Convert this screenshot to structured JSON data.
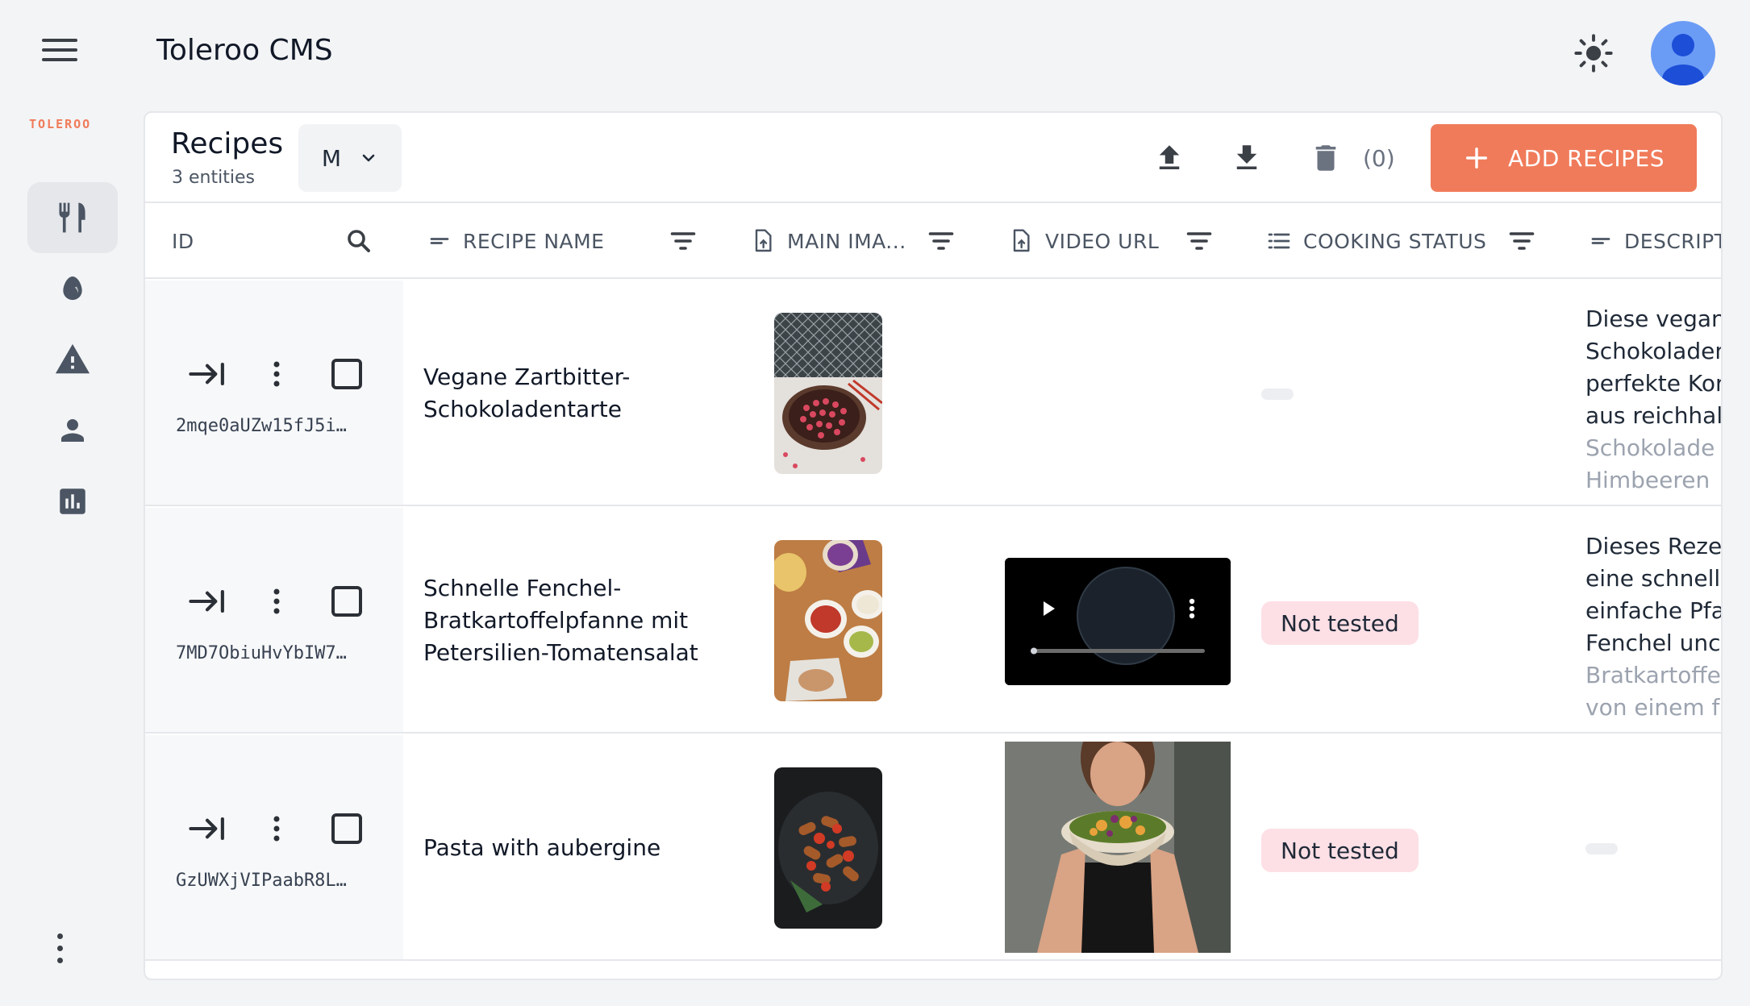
{
  "app": {
    "title": "Toleroo CMS",
    "brand": "TOLEROO"
  },
  "toolbar": {
    "title": "Recipes",
    "entity_count": "3 entities",
    "size_value": "M",
    "selected_count": "(0)",
    "add_label": "ADD RECIPES"
  },
  "sidebar": {
    "items": [
      {
        "icon": "utensils-icon",
        "active": true
      },
      {
        "icon": "egg-icon",
        "active": false
      },
      {
        "icon": "warning-icon",
        "active": false
      },
      {
        "icon": "person-icon",
        "active": false
      },
      {
        "icon": "chart-icon",
        "active": false
      }
    ]
  },
  "columns": {
    "id": "ID",
    "recipe_name": "RECIPE NAME",
    "main_image": "MAIN IMA...",
    "video_url": "VIDEO URL",
    "cooking_status": "COOKING STATUS",
    "description": "DESCRIPT"
  },
  "rows": [
    {
      "id": "2mqe0aUZw15fJ5i…",
      "name": "Vegane Zartbitter-Schokoladentarte",
      "image": "tart-photo",
      "video": "",
      "status": "",
      "desc_top": "Diese vegan\nSchokoladen\nperfekte Kor\naus reichhal",
      "desc_fade": "Schokolade\nHimbeeren"
    },
    {
      "id": "7MD7ObiuHvYbIW7…",
      "name": "Schnelle Fenchel-Bratkartoffelpfanne mit Petersilien-Tomatensalat",
      "image": "bowls-photo",
      "video": "player",
      "status": "Not tested",
      "desc_top": "Dieses Reze\neine schnell\neinfache Pfa\nFenchel unc",
      "desc_fade": "Bratkartoffe\nvon einem fr"
    },
    {
      "id": "GzUWXjVIPaabR8L…",
      "name": "Pasta with aubergine",
      "image": "pasta-photo",
      "video": "woman-photo",
      "status": "Not tested",
      "desc_top": "",
      "desc_fade": ""
    }
  ],
  "colors": {
    "accent": "#f07b5a",
    "badge_bg": "#fde0e6",
    "avatar": "#6b9cf5"
  }
}
